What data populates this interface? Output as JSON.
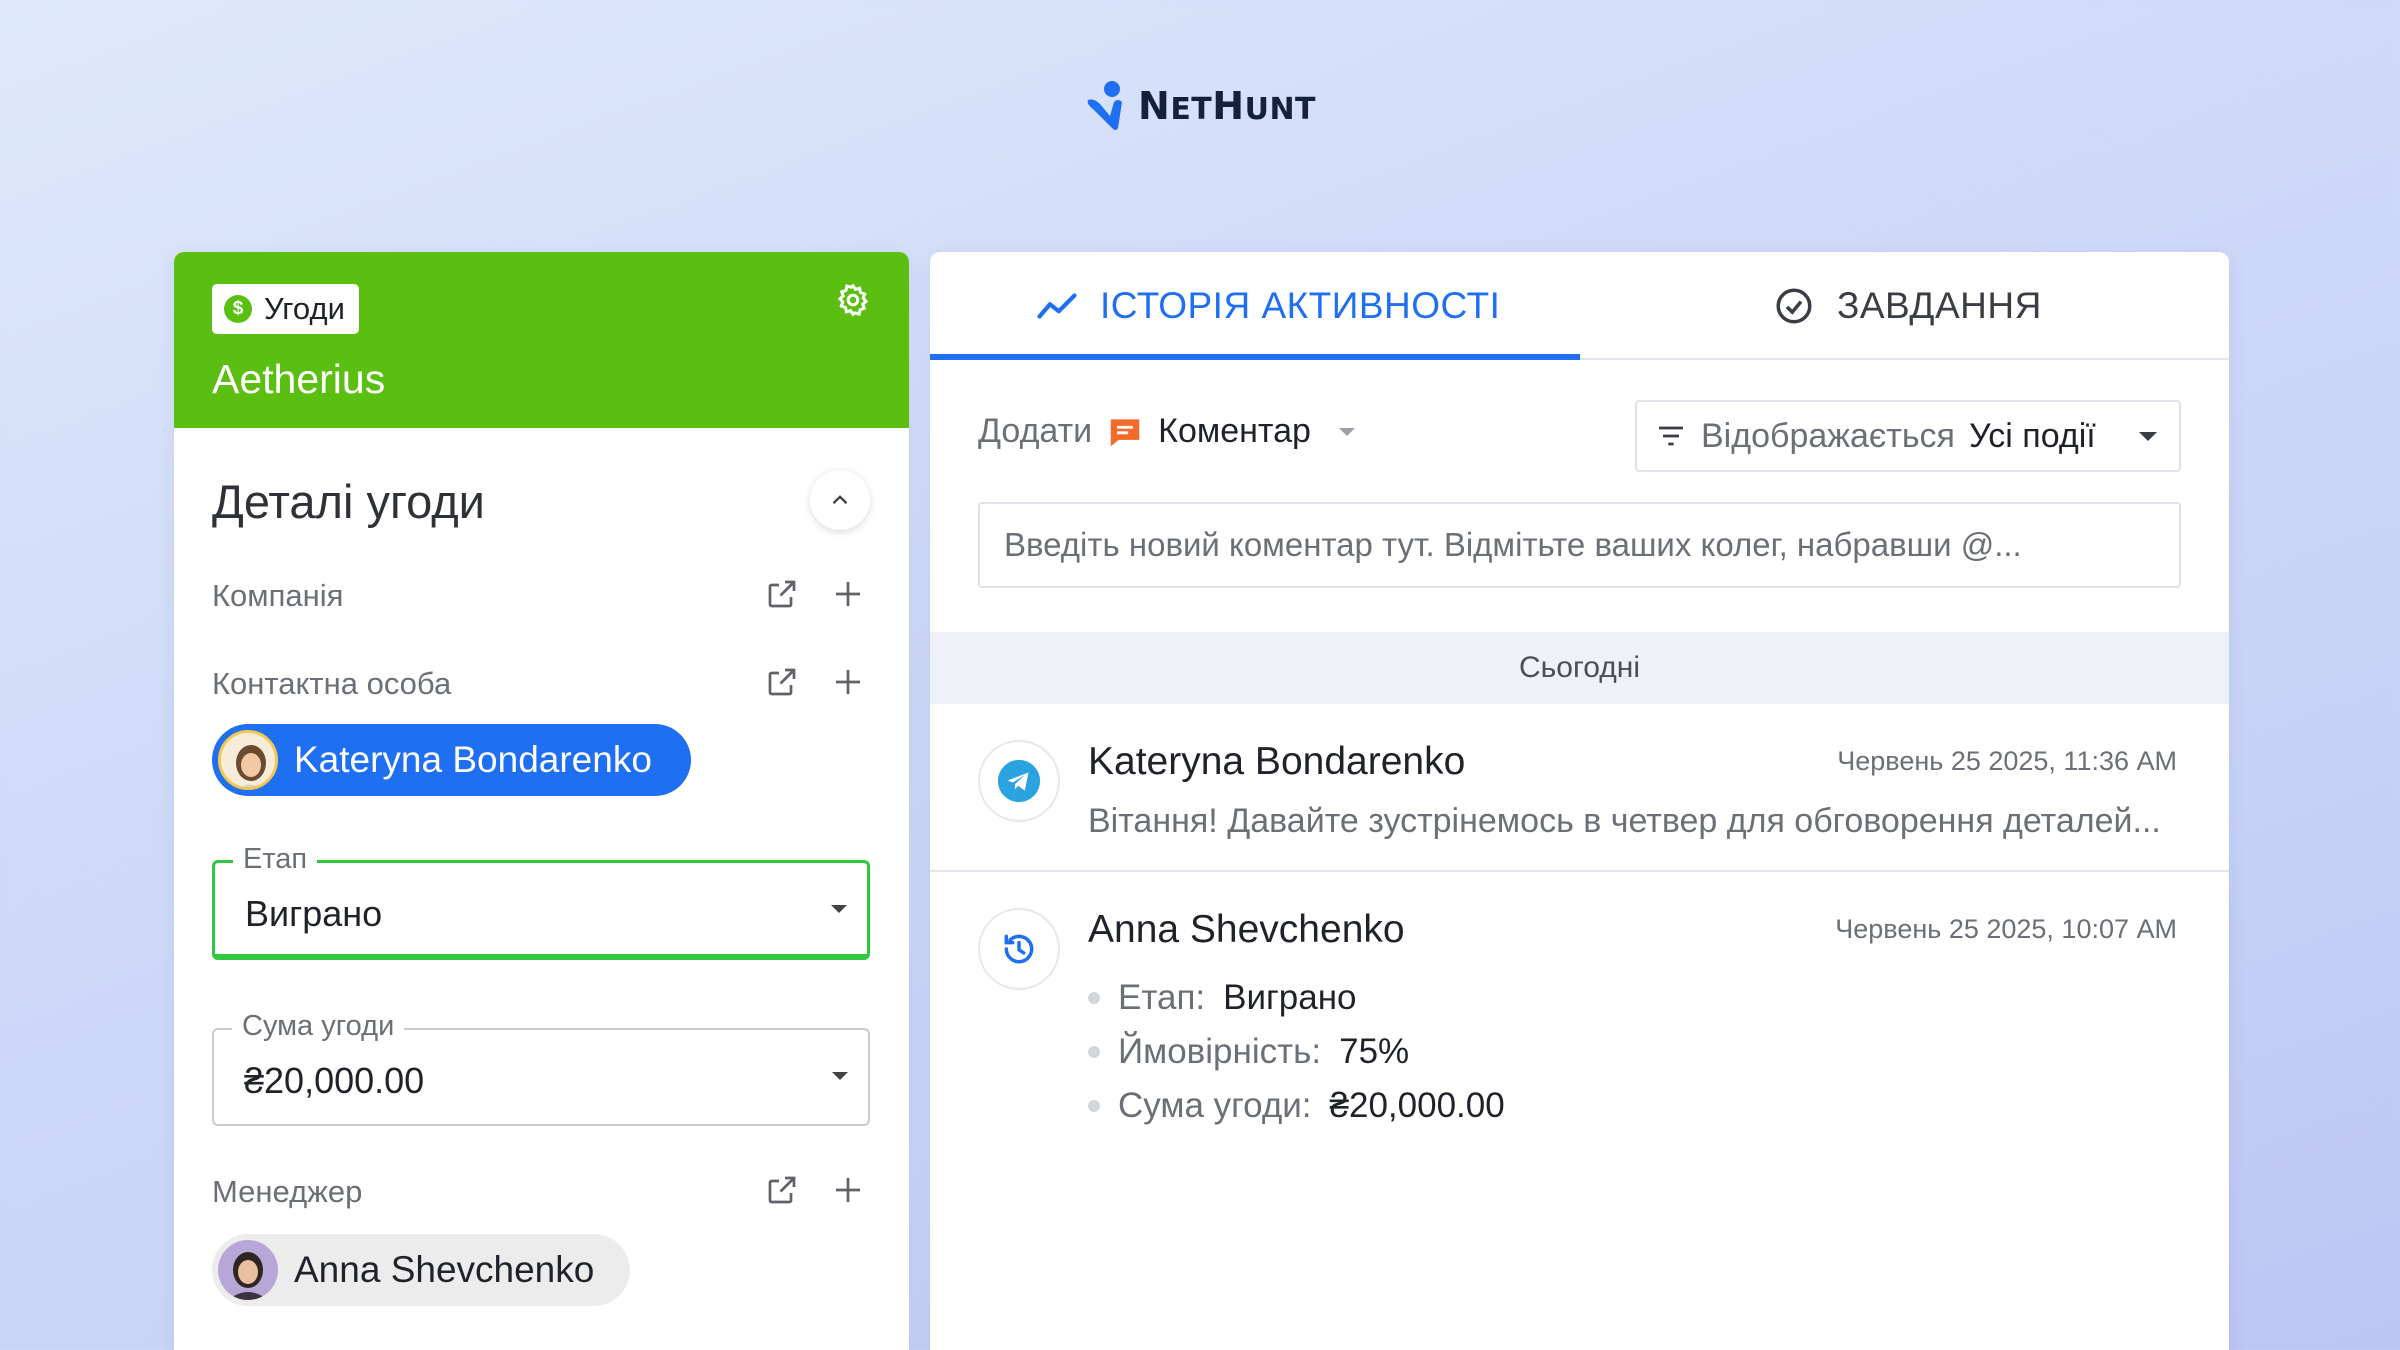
{
  "brand": {
    "logo_text": "NetHunt",
    "accent": "#1e6ff1",
    "green": "#5bbf12"
  },
  "left": {
    "badge_label": "Угоди",
    "badge_icon": "dollar-icon",
    "deal_name": "Aetherius",
    "section_title": "Деталі угоди",
    "fields": {
      "company_label": "Компанія",
      "contact_label": "Контактна особа",
      "contact_name": "Kateryna Bondarenko",
      "stage_label": "Етап",
      "stage_value": "Виграно",
      "amount_label": "Сума угоди",
      "amount_value": "₴20,000.00",
      "manager_label": "Менеджер",
      "manager_name": "Anna Shevchenko"
    }
  },
  "right": {
    "tabs": [
      {
        "label": "ІСТОРІЯ АКТИВНОСТІ",
        "icon": "activity-icon",
        "active": true
      },
      {
        "label": "ЗАВДАННЯ",
        "icon": "check-circle-icon",
        "active": false
      }
    ],
    "add_label": "Додати",
    "add_type": "Коментар",
    "filter_label": "Відображається",
    "filter_value": "Усі події",
    "comment_placeholder": "Введіть новий коментар тут. Відмітьте ваших колег, набравши @...",
    "day_label": "Сьогодні",
    "activities": [
      {
        "name": "Kateryna Bondarenko",
        "time": "Червень 25 2025, 11:36 AM",
        "icon": "telegram-icon",
        "message": "Вітання! Давайте зустрінемось в четвер для обговорення деталей..."
      },
      {
        "name": "Anna Shevchenko",
        "time": "Червень 25 2025, 10:07 AM",
        "icon": "history-icon",
        "changes": [
          {
            "key": "Етап:",
            "value": "Виграно"
          },
          {
            "key": "Ймовірність:",
            "value": "75%"
          },
          {
            "key": "Сума угоди:",
            "value": "₴20,000.00"
          }
        ]
      }
    ]
  }
}
